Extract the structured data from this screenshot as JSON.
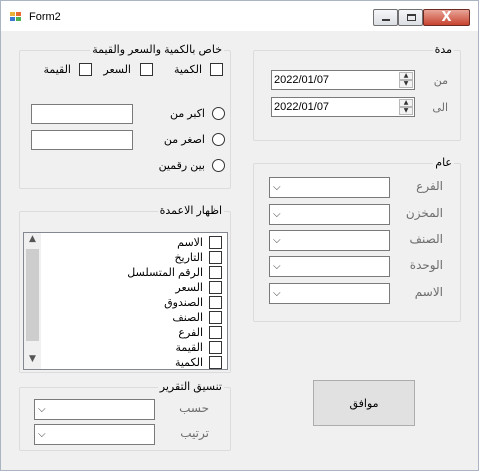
{
  "window": {
    "title": "Form2",
    "icon": "app-form-icon",
    "controls": [
      "minimize-icon",
      "maximize-icon",
      "close-icon"
    ],
    "close_glyph": "X"
  },
  "qty_price_group": {
    "title": "خاص بالكمية والسعر والقيمة",
    "checkboxes": [
      {
        "label": "الكمية",
        "checked": false
      },
      {
        "label": "السعر",
        "checked": false
      },
      {
        "label": "القيمة",
        "checked": false
      }
    ],
    "radios": [
      {
        "label": "اكبر من",
        "checked": false,
        "value": ""
      },
      {
        "label": "اصغر من",
        "checked": false,
        "value": ""
      },
      {
        "label": "بين رقمين",
        "checked": false
      }
    ]
  },
  "period_group": {
    "title": "مدة",
    "from_label": "من",
    "to_label": "الى",
    "from_date": "2022/01/07",
    "to_date": "2022/01/07"
  },
  "general_group": {
    "title": "عام",
    "fields": [
      {
        "label": "الفرع",
        "value": ""
      },
      {
        "label": "المخزن",
        "value": ""
      },
      {
        "label": "الصنف",
        "value": ""
      },
      {
        "label": "الوحدة",
        "value": ""
      },
      {
        "label": "الاسم",
        "value": ""
      }
    ]
  },
  "columns_group": {
    "title": "اظهار الاعمدة",
    "items": [
      {
        "label": "الاسم",
        "checked": false
      },
      {
        "label": "التاريخ",
        "checked": false
      },
      {
        "label": "الرقم المتسلسل",
        "checked": false
      },
      {
        "label": "السعر",
        "checked": false
      },
      {
        "label": "الصندوق",
        "checked": false
      },
      {
        "label": "الصنف",
        "checked": false
      },
      {
        "label": "الفرع",
        "checked": false
      },
      {
        "label": "القيمة",
        "checked": false
      },
      {
        "label": "الكمية",
        "checked": false
      }
    ]
  },
  "format_group": {
    "title": "تنسيق التقرير",
    "by_label": "حسب",
    "order_label": "ترتيب",
    "by_value": "",
    "order_value": ""
  },
  "ok_button": {
    "label": "موافق"
  }
}
